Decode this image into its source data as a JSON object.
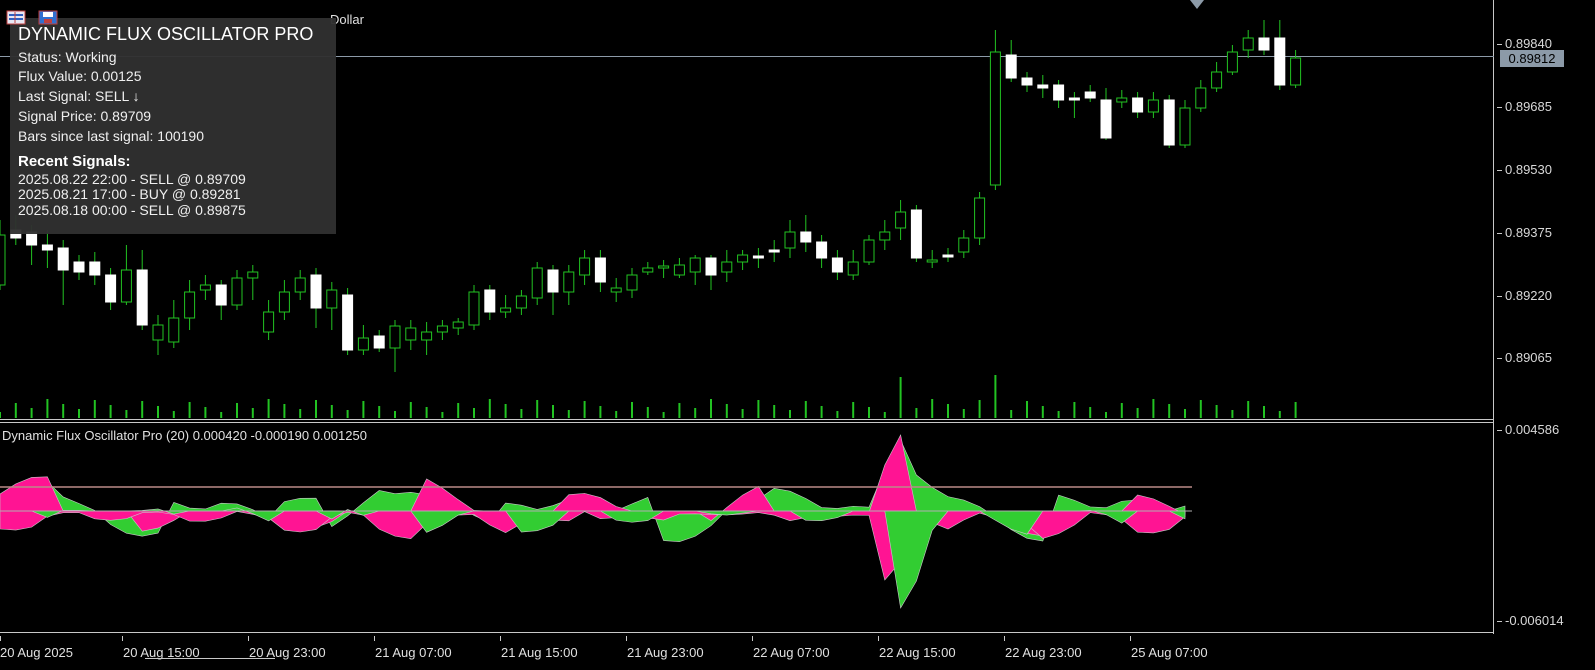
{
  "chart": {
    "symbol_text": "Dollar",
    "current_price": "0.89812",
    "price_labels": [
      "0.89840",
      "0.89685",
      "0.89530",
      "0.89375",
      "0.89220",
      "0.89065"
    ],
    "time_labels": [
      "20 Aug 2025",
      "20 Aug 15:00",
      "20 Aug 23:00",
      "21 Aug 07:00",
      "21 Aug 15:00",
      "21 Aug 23:00",
      "22 Aug 07:00",
      "22 Aug 15:00",
      "22 Aug 23:00",
      "25 Aug 07:00"
    ]
  },
  "indicator": {
    "title": "Dynamic Flux Oscillator Pro (20) 0.000420 -0.000190 0.001250",
    "scale_top": "0.004586",
    "scale_bottom": "-0.006014"
  },
  "info_panel": {
    "title": "DYNAMIC FLUX OSCILLATOR PRO",
    "status": "Status: Working",
    "flux_value": "Flux Value: 0.00125",
    "last_signal": "Last Signal: SELL ↓",
    "signal_price": "Signal Price: 0.89709",
    "bars_since": "Bars since last signal: 100190",
    "recent_heading": "Recent Signals:",
    "signals": [
      "2025.08.22 22:00 - SELL @ 0.89709",
      "2025.08.21 17:00 - BUY @ 0.89281",
      "2025.08.18 00:00 - SELL @ 0.89875"
    ]
  },
  "colors": {
    "bull": "#22c322",
    "bear": "#ffffff",
    "osc_positive": "#32cd32",
    "osc_negative": "#ff1493",
    "signal_line": "#ff69b4",
    "frame": "#c8c8c8"
  },
  "icons": [
    "list-icon",
    "save-icon"
  ]
}
